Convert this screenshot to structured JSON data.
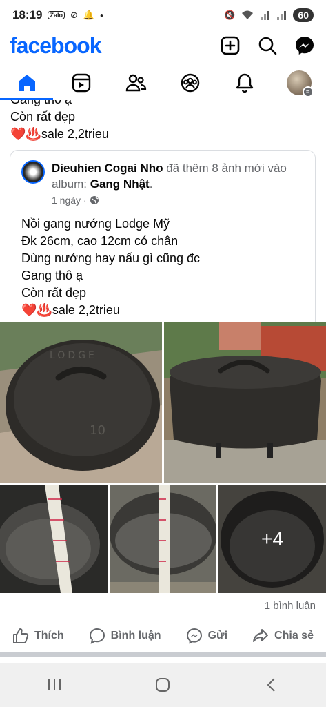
{
  "status": {
    "time": "18:19",
    "zalo": "Zalo",
    "battery": "60"
  },
  "header": {
    "logo": "facebook"
  },
  "previous_post": {
    "line1": "Gang thô ạ",
    "line2": "Còn rất đẹp",
    "line3": "❤️♨️sale 2,2trieu"
  },
  "post": {
    "author": "Dieuhien Cogai Nho",
    "action": " đã thêm 8 ảnh mới vào album: ",
    "album": "Gang Nhật",
    "album_suffix": ".",
    "time": "1 ngày",
    "separator": "·",
    "privacy_icon": "globe-icon",
    "body": [
      "Nồi gang nướng Lodge Mỹ",
      "Đk 26cm, cao 12cm có chân",
      "Dùng nướng hay nấu gì cũng đc",
      "Gang thô ạ",
      "Còn rất đẹp",
      "❤️♨️sale 2,2trieu"
    ],
    "more_photos": "+4",
    "comments": "1 bình luận"
  },
  "actions": {
    "like": "Thích",
    "comment": "Bình luận",
    "send": "Gửi",
    "share": "Chia sẻ"
  },
  "colors": {
    "brand": "#0866ff",
    "muted": "#65676b"
  }
}
